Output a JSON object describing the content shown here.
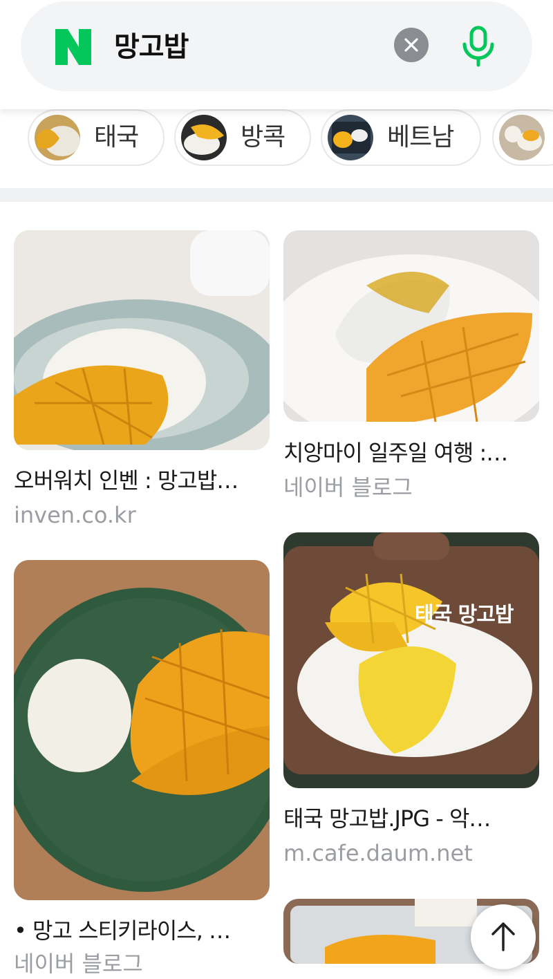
{
  "search": {
    "query": "망고밥"
  },
  "chips": [
    {
      "label": "태국"
    },
    {
      "label": "방콕"
    },
    {
      "label": "베트남"
    },
    {
      "label": ""
    }
  ],
  "results": [
    {
      "title": "오버워치 인벤 : 망고밥…",
      "source": "inven.co.kr"
    },
    {
      "title": "치앙마이 일주일 여행 :…",
      "source": "네이버 블로그"
    },
    {
      "title": "• 망고 스티키라이스, …",
      "source": "네이버 블로그"
    },
    {
      "title": "태국 망고밥.JPG - 악…",
      "source": "m.cafe.daum.net",
      "image_caption": "태국 망고밥"
    }
  ],
  "icons": {
    "logo": "naver-n-logo",
    "clear": "close-icon",
    "mic": "microphone-icon",
    "top": "arrow-up-icon"
  },
  "colors": {
    "brand": "#03c75a",
    "clear_bg": "#8a8d91"
  }
}
